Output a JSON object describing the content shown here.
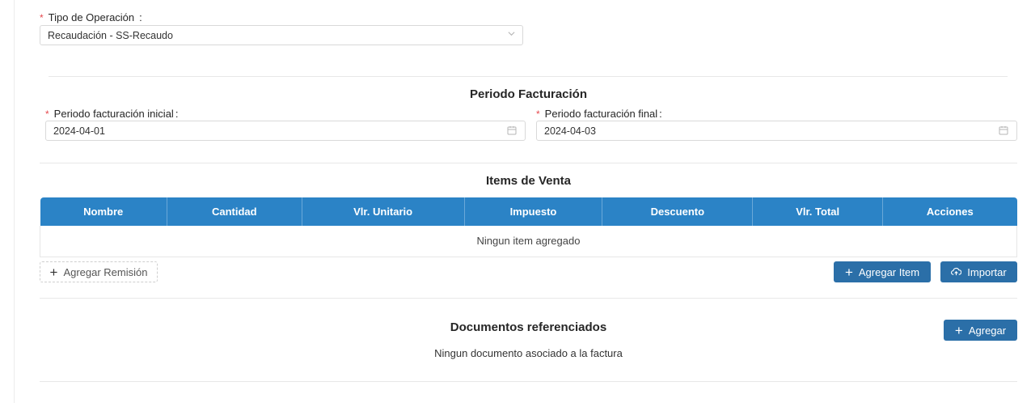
{
  "operation": {
    "required_mark": "*",
    "label": "Tipo de Operación",
    "colon": ":",
    "value": "Recaudación - SS-Recaudo"
  },
  "billing_period": {
    "title": "Periodo Facturación",
    "start": {
      "required_mark": "*",
      "label": "Periodo facturación inicial",
      "colon": ":",
      "value": "2024-04-01"
    },
    "end": {
      "required_mark": "*",
      "label": "Periodo facturación final",
      "colon": ":",
      "value": "2024-04-03"
    }
  },
  "sale_items": {
    "title": "Items de Venta",
    "columns": [
      "Nombre",
      "Cantidad",
      "Vlr. Unitario",
      "Impuesto",
      "Descuento",
      "Vlr. Total",
      "Acciones"
    ],
    "empty_message": "Ningun item agregado",
    "add_remission_label": "Agregar Remisión",
    "add_item_label": "Agregar Item",
    "import_label": "Importar"
  },
  "referenced_documents": {
    "title": "Documentos referenciados",
    "add_label": "Agregar",
    "empty_message": "Ningun documento asociado a la factura"
  },
  "colors": {
    "table_header": "#2b83c6",
    "primary_button": "#2b6fa8",
    "required": "#e5484d"
  },
  "icons": {
    "select_arrow": "chevron-down-icon",
    "date": "calendar-icon",
    "add": "plus-icon",
    "import": "cloud-upload-icon"
  }
}
